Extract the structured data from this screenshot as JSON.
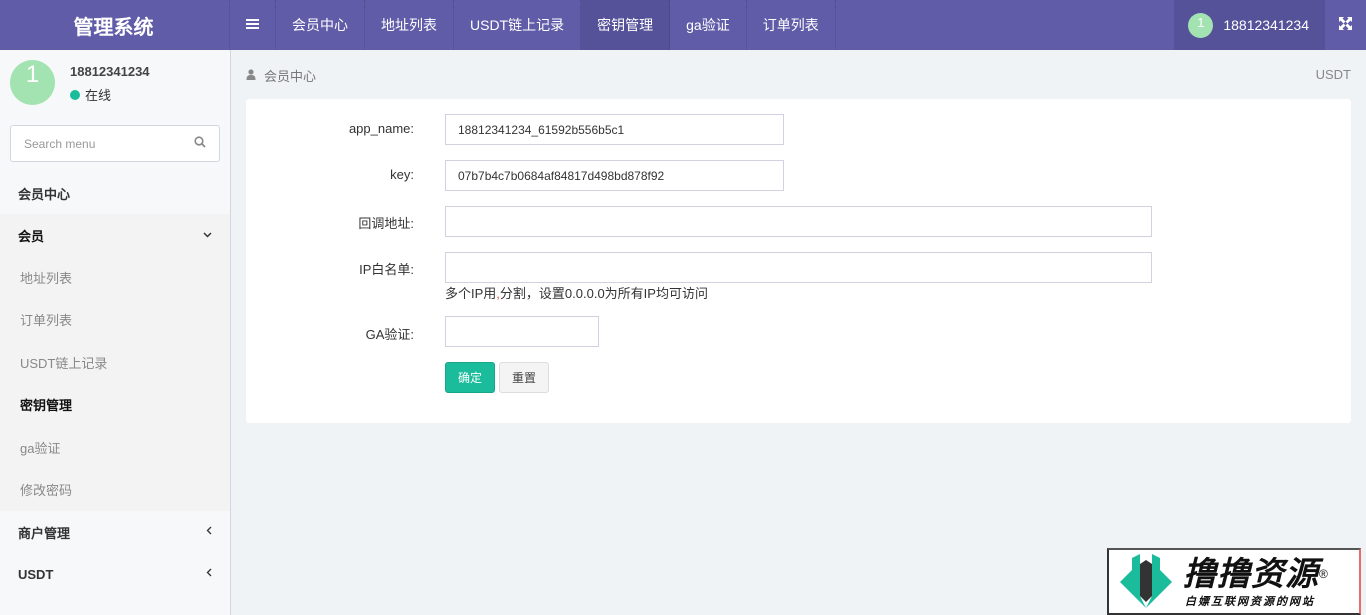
{
  "app": {
    "title": "管理系统"
  },
  "header": {
    "toggle_icon": "menu-bars-icon",
    "nav": [
      {
        "label": "会员中心",
        "active": false
      },
      {
        "label": "地址列表",
        "active": false
      },
      {
        "label": "USDT链上记录",
        "active": false
      },
      {
        "label": "密钥管理",
        "active": true
      },
      {
        "label": "ga验证",
        "active": false
      },
      {
        "label": "订单列表",
        "active": false
      }
    ],
    "user": {
      "avatar_text": "1",
      "name": "18812341234"
    },
    "fullscreen_icon": "expand-arrows-icon"
  },
  "sidebar": {
    "user": {
      "avatar_text": "1",
      "name": "18812341234",
      "status": "在线",
      "status_color": "#1bbc9b"
    },
    "search": {
      "placeholder": "Search menu",
      "value": ""
    },
    "menu": [
      {
        "label": "会员中心",
        "type": "item"
      },
      {
        "label": "会员",
        "type": "group",
        "expanded": true,
        "chevron": "⌄",
        "children": [
          {
            "label": "地址列表",
            "active": false
          },
          {
            "label": "订单列表",
            "active": false
          },
          {
            "label": "USDT链上记录",
            "active": false
          },
          {
            "label": "密钥管理",
            "active": true
          },
          {
            "label": "ga验证",
            "active": false
          },
          {
            "label": "修改密码",
            "active": false
          }
        ]
      },
      {
        "label": "商户管理",
        "type": "group",
        "expanded": false,
        "chevron": "‹"
      },
      {
        "label": "USDT",
        "type": "group",
        "expanded": false,
        "chevron": "‹"
      }
    ]
  },
  "breadcrumb": {
    "icon": "user-icon",
    "label": "会员中心",
    "right": "USDT"
  },
  "form": {
    "fields": [
      {
        "label": "app_name:",
        "value": "18812341234_61592b556b5c1",
        "placeholder": ""
      },
      {
        "label": "key:",
        "value": "07b7b4c7b0684af84817d498bd878f92",
        "placeholder": ""
      },
      {
        "label": "回调地址:",
        "value": "",
        "placeholder": ""
      },
      {
        "label": "IP白名单:",
        "value": "",
        "placeholder": ""
      },
      {
        "label": "GA验证:",
        "value": "",
        "placeholder": ""
      }
    ],
    "ip_help": {
      "before": "多个IP用",
      "separator": ",",
      "after": "分割，设置0.0.0.0为所有IP均可访问",
      "separator_color": "#e74c3c"
    },
    "submit_label": "确定",
    "reset_label": "重置",
    "accent": "#1bbc9b"
  },
  "watermark": {
    "title": "撸撸资源",
    "registered": "®",
    "subtitle": "白嫖互联网资源的网站"
  }
}
